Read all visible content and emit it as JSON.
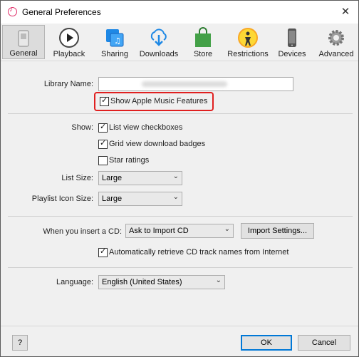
{
  "window": {
    "title": "General Preferences",
    "close_glyph": "✕"
  },
  "toolbar": {
    "items": [
      {
        "label": "General",
        "icon": "general-icon",
        "active": true
      },
      {
        "label": "Playback",
        "icon": "play-icon"
      },
      {
        "label": "Sharing",
        "icon": "sharing-icon"
      },
      {
        "label": "Downloads",
        "icon": "download-cloud-icon"
      },
      {
        "label": "Store",
        "icon": "store-bag-icon"
      },
      {
        "label": "Restrictions",
        "icon": "restrictions-icon"
      },
      {
        "label": "Devices",
        "icon": "device-icon"
      },
      {
        "label": "Advanced",
        "icon": "gear-icon"
      }
    ]
  },
  "library": {
    "label": "Library Name:",
    "value": ""
  },
  "apple_music": {
    "label": "Show Apple Music Features",
    "checked": true
  },
  "show": {
    "label": "Show:",
    "options": [
      {
        "label": "List view checkboxes",
        "checked": true
      },
      {
        "label": "Grid view download badges",
        "checked": true
      },
      {
        "label": "Star ratings",
        "checked": false
      }
    ]
  },
  "list_size": {
    "label": "List Size:",
    "value": "Large"
  },
  "playlist_icon_size": {
    "label": "Playlist Icon Size:",
    "value": "Large"
  },
  "insert_cd": {
    "label": "When you insert a CD:",
    "value": "Ask to Import CD",
    "import_button": "Import Settings..."
  },
  "auto_retrieve": {
    "label": "Automatically retrieve CD track names from Internet",
    "checked": true
  },
  "language": {
    "label": "Language:",
    "value": "English (United States)"
  },
  "footer": {
    "help": "?",
    "ok": "OK",
    "cancel": "Cancel"
  },
  "colors": {
    "highlight": "#e02020",
    "ok_border": "#0078d7"
  }
}
